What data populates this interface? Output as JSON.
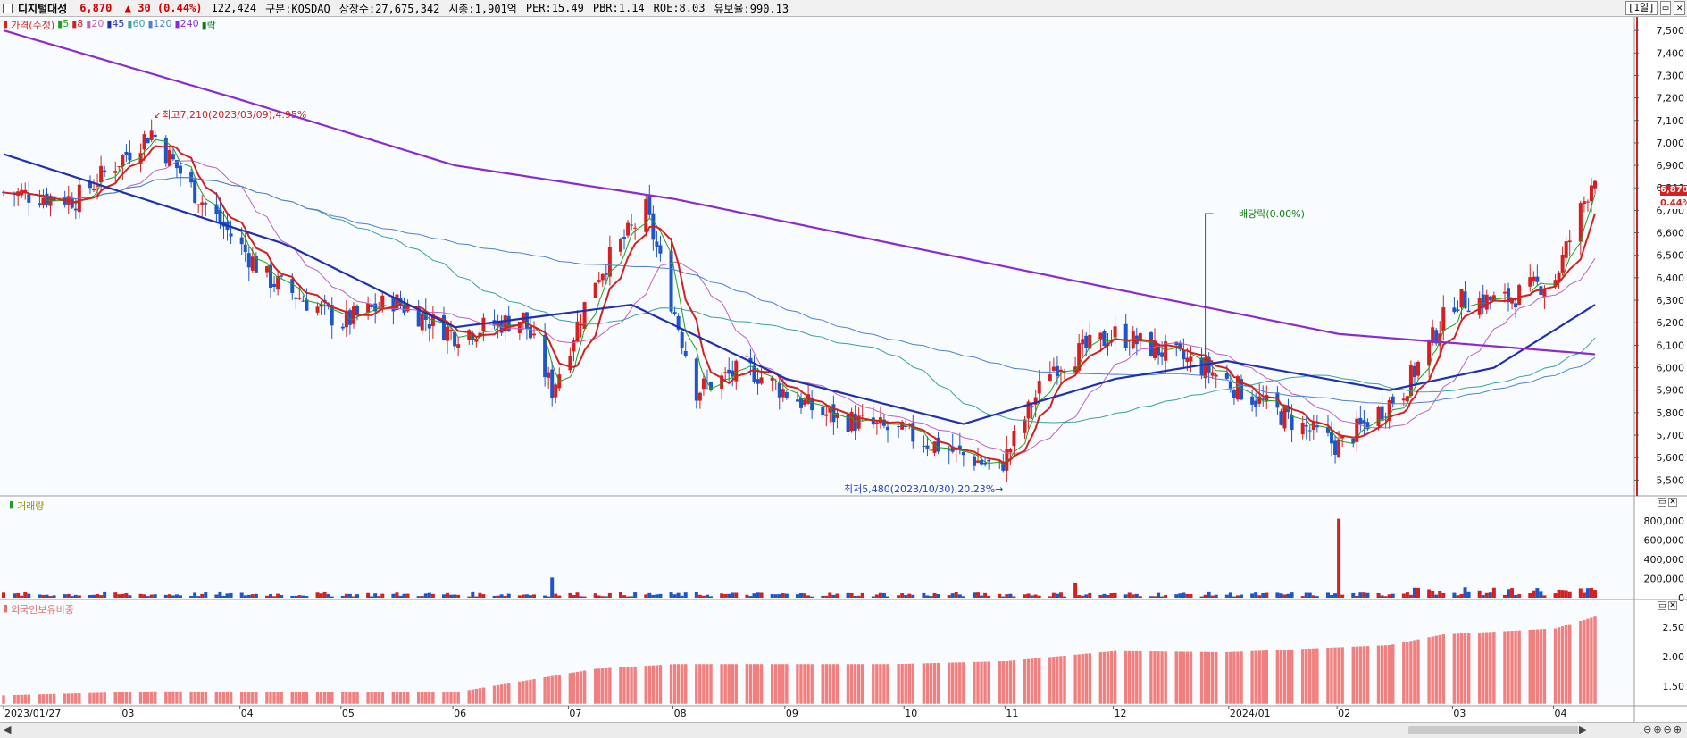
{
  "header": {
    "stock_name": "디지털대성",
    "price": "6,870",
    "change_arrow": "▲",
    "change": "30",
    "change_pct": "(0.44%)",
    "volume": "122,424",
    "market": "구분:KOSDAQ",
    "shares": "상장수:27,675,342",
    "mktcap": "시총:1,901억",
    "per": "PER:15.49",
    "pbr": "PBR:1.14",
    "roe": "ROE:8.03",
    "float": "유보율:990.13",
    "period": "[1일]"
  },
  "legend": {
    "price_label": "가격(수정)",
    "ma": [
      {
        "label": "5",
        "color": "#1f9e1f"
      },
      {
        "label": "8",
        "color": "#d42020"
      },
      {
        "label": "20",
        "color": "#c060c0"
      },
      {
        "label": "45",
        "color": "#2030b0"
      },
      {
        "label": "60",
        "color": "#3aa0a0"
      },
      {
        "label": "120",
        "color": "#5080d0"
      },
      {
        "label": "240",
        "color": "#8a2bd0"
      },
      {
        "label": "락",
        "color": "#108010"
      }
    ],
    "volume_label": "거래량",
    "foreign_label": "외국인보유비중"
  },
  "annotations": {
    "high": "최고7,210(2023/03/09),4.95%",
    "low": "최저5,480(2023/10/30),20.23%",
    "dividend": "배당락(0.00%)",
    "last_price": "6,870",
    "last_pct": "0.44%"
  },
  "chart_data": [
    {
      "type": "candlestick",
      "title": "디지털대성",
      "x_range": [
        "2023/01/27",
        "2024/04/12"
      ],
      "x_tick_labels": [
        "2023/01/27",
        "03",
        "04",
        "05",
        "06",
        "07",
        "08",
        "09",
        "10",
        "11",
        "12",
        "2024/01",
        "02",
        "03",
        "04"
      ],
      "y_ticks": [
        "5,500",
        "5,600",
        "5,700",
        "5,800",
        "5,900",
        "6,000",
        "6,100",
        "6,200",
        "6,300",
        "6,400",
        "6,500",
        "6,600",
        "6,700",
        "6,800",
        "6,900",
        "7,000",
        "7,100",
        "7,200",
        "7,300",
        "7,400",
        "7,500"
      ],
      "ylim": [
        5430,
        7560
      ],
      "price_path": [
        {
          "date": "2023/01/27",
          "close": 6780
        },
        {
          "date": "2023/02/16",
          "close": 6750
        },
        {
          "date": "2023/03/09",
          "close": 7050
        },
        {
          "date": "2023/03/20",
          "close": 6800
        },
        {
          "date": "2023/04/10",
          "close": 6400
        },
        {
          "date": "2023/05/01",
          "close": 6200
        },
        {
          "date": "2023/05/15",
          "close": 6300
        },
        {
          "date": "2023/06/01",
          "close": 6150
        },
        {
          "date": "2023/06/20",
          "close": 6220
        },
        {
          "date": "2023/06/28",
          "close": 5900
        },
        {
          "date": "2023/07/10",
          "close": 6400
        },
        {
          "date": "2023/07/24",
          "close": 6700
        },
        {
          "date": "2023/08/07",
          "close": 5900
        },
        {
          "date": "2023/08/21",
          "close": 6000
        },
        {
          "date": "2023/09/10",
          "close": 5800
        },
        {
          "date": "2023/10/05",
          "close": 5700
        },
        {
          "date": "2023/10/30",
          "close": 5550
        },
        {
          "date": "2023/11/13",
          "close": 6000
        },
        {
          "date": "2023/12/01",
          "close": 6150
        },
        {
          "date": "2023/12/26",
          "close": 6000
        },
        {
          "date": "2024/01/15",
          "close": 5800
        },
        {
          "date": "2024/02/01",
          "close": 5650
        },
        {
          "date": "2024/02/19",
          "close": 5900
        },
        {
          "date": "2024/03/04",
          "close": 6300
        },
        {
          "date": "2024/03/18",
          "close": 6300
        },
        {
          "date": "2024/04/01",
          "close": 6400
        },
        {
          "date": "2024/04/12",
          "close": 6870
        }
      ],
      "ma_240_path": [
        {
          "date": "2023/01/27",
          "value": 7500
        },
        {
          "date": "2023/04/01",
          "value": 7200
        },
        {
          "date": "2023/06/01",
          "value": 6900
        },
        {
          "date": "2023/08/01",
          "value": 6750
        },
        {
          "date": "2023/10/01",
          "value": 6550
        },
        {
          "date": "2023/12/01",
          "value": 6350
        },
        {
          "date": "2024/02/01",
          "value": 6150
        },
        {
          "date": "2024/04/12",
          "value": 6060
        }
      ],
      "ma_45_path": [
        {
          "date": "2023/01/27",
          "value": 6950
        },
        {
          "date": "2023/03/01",
          "value": 6780
        },
        {
          "date": "2023/04/15",
          "value": 6550
        },
        {
          "date": "2023/06/01",
          "value": 6180
        },
        {
          "date": "2023/07/20",
          "value": 6280
        },
        {
          "date": "2023/09/01",
          "value": 5950
        },
        {
          "date": "2023/10/20",
          "value": 5750
        },
        {
          "date": "2023/12/01",
          "value": 5950
        },
        {
          "date": "2024/01/01",
          "value": 6030
        },
        {
          "date": "2024/02/15",
          "value": 5900
        },
        {
          "date": "2024/03/15",
          "value": 6000
        },
        {
          "date": "2024/04/12",
          "value": 6280
        }
      ]
    },
    {
      "type": "bar",
      "title": "거래량",
      "y_ticks": [
        "0",
        "200,000",
        "400,000",
        "600,000",
        "800,000"
      ],
      "ylim": [
        0,
        900000
      ],
      "peaks": [
        {
          "date": "2023/06/28",
          "value": 210000
        },
        {
          "date": "2023/11/20",
          "value": 150000
        },
        {
          "date": "2024/02/01",
          "value": 820000
        },
        {
          "date": "2024/03/04",
          "value": 260000
        }
      ]
    },
    {
      "type": "bar",
      "title": "외국인보유비중",
      "y_ticks": [
        "1.50",
        "2.00",
        "2.50"
      ],
      "ylim": [
        1.2,
        2.8
      ],
      "path": [
        {
          "date": "2023/01/27",
          "value": 1.35
        },
        {
          "date": "2023/03/10",
          "value": 1.42
        },
        {
          "date": "2023/06/01",
          "value": 1.4
        },
        {
          "date": "2023/07/10",
          "value": 1.8
        },
        {
          "date": "2023/08/01",
          "value": 1.88
        },
        {
          "date": "2023/10/01",
          "value": 1.88
        },
        {
          "date": "2023/11/01",
          "value": 1.93
        },
        {
          "date": "2023/12/01",
          "value": 2.1
        },
        {
          "date": "2024/01/01",
          "value": 2.08
        },
        {
          "date": "2024/02/15",
          "value": 2.2
        },
        {
          "date": "2024/03/01",
          "value": 2.38
        },
        {
          "date": "2024/04/01",
          "value": 2.48
        },
        {
          "date": "2024/04/12",
          "value": 2.68
        }
      ]
    }
  ]
}
